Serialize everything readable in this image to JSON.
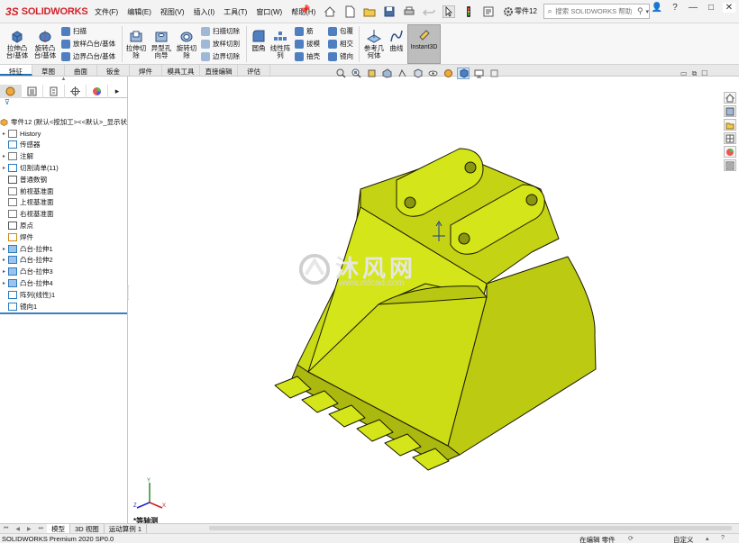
{
  "app": {
    "logo_ds": "3S",
    "logo_brand": "SOLIDWORKS",
    "document_name": "零件12"
  },
  "menu": [
    "文件(F)",
    "编辑(E)",
    "视图(V)",
    "插入(I)",
    "工具(T)",
    "窗口(W)",
    "帮助(H)"
  ],
  "search": {
    "placeholder": "搜索 SOLIDWORKS 帮助"
  },
  "ribbon": {
    "extrude_boss": "拉伸凸\n台/基体",
    "revolve_boss": "旋转凸\n台/基体",
    "sweep": "扫描",
    "loft_boss": "放样凸台/基体",
    "boundary_boss": "边界凸台/基体",
    "extrude_cut": "拉伸切\n除",
    "hole_wizard": "异型孔\n向导",
    "revolve_cut": "旋转切\n除",
    "swept_cut": "扫描切除",
    "lofted_cut": "放样切割",
    "boundary_cut": "边界切除",
    "fillet": "圆角",
    "linear_pattern": "线性阵\n列",
    "rib": "筋",
    "draft": "拔模",
    "shell": "抽壳",
    "wrap": "包覆",
    "intersect": "相交",
    "mirror": "镜向",
    "reference_geometry": "参考几\n何体",
    "curves": "曲线",
    "instant3d": "Instant3D"
  },
  "tabs": [
    "特征",
    "草图",
    "曲面",
    "钣金",
    "焊件",
    "模具工具",
    "直接编辑",
    "评估"
  ],
  "tree": {
    "root": "零件12 (默认<按加工><<默认>_显示状",
    "items": [
      {
        "label": "History",
        "arrow": "▸"
      },
      {
        "label": "传感器",
        "arrow": ""
      },
      {
        "label": "注解",
        "arrow": "▸"
      },
      {
        "label": "切割清单(11)",
        "arrow": "▸"
      },
      {
        "label": "普通数钢",
        "arrow": ""
      },
      {
        "label": "前视基准面",
        "arrow": ""
      },
      {
        "label": "上视基准面",
        "arrow": ""
      },
      {
        "label": "右视基准面",
        "arrow": ""
      },
      {
        "label": "原点",
        "arrow": ""
      },
      {
        "label": "焊件",
        "arrow": ""
      },
      {
        "label": "凸台-拉伸1",
        "arrow": "▸"
      },
      {
        "label": "凸台-拉伸2",
        "arrow": "▸"
      },
      {
        "label": "凸台-拉伸3",
        "arrow": "▸"
      },
      {
        "label": "凸台-拉伸4",
        "arrow": "▸"
      },
      {
        "label": "阵列(线性)1",
        "arrow": ""
      },
      {
        "label": "镜向1",
        "arrow": ""
      }
    ]
  },
  "viewport": {
    "view_label": "*等轴测",
    "model_color": "#d4e619",
    "watermark_text": "沐风网",
    "watermark_url": "www.mfcad.com"
  },
  "bottom_tabs": [
    "模型",
    "3D 视图",
    "运动算例 1"
  ],
  "status": {
    "app_version": "SOLIDWORKS Premium 2020 SP0.0",
    "editing": "在编辑 零件",
    "units": "自定义"
  }
}
